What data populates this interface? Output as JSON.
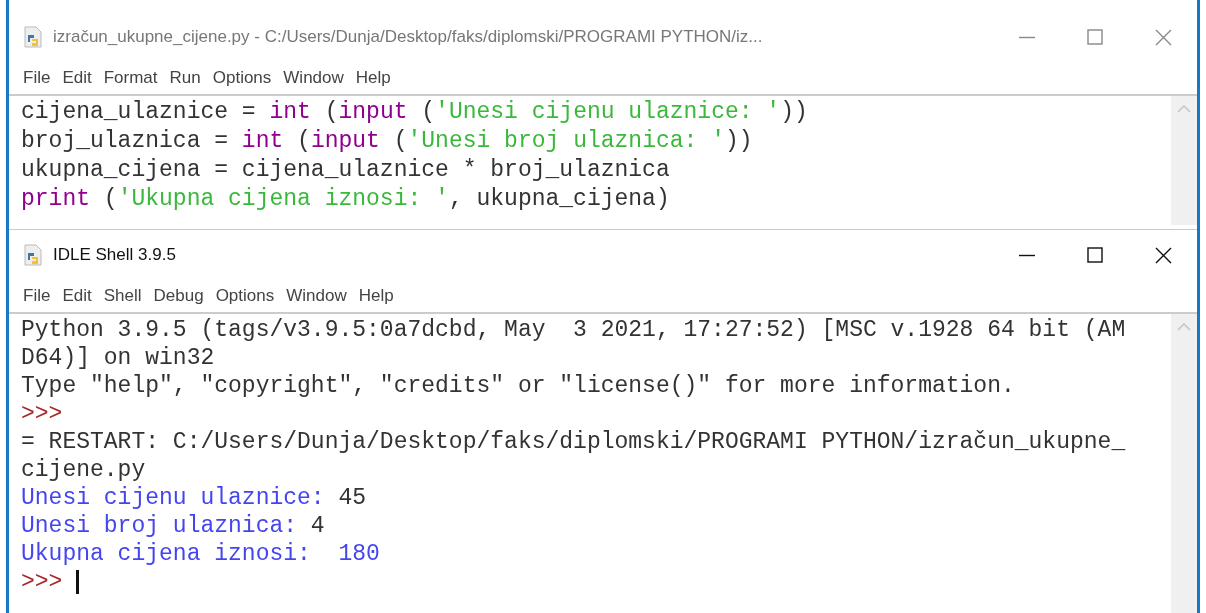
{
  "editor_window": {
    "title": "izračun_ukupne_cijene.py - C:/Users/Dunja/Desktop/faks/diplomski/PROGRAMI PYTHON/iz...",
    "active": false,
    "menu": [
      "File",
      "Edit",
      "Format",
      "Run",
      "Options",
      "Window",
      "Help"
    ],
    "code_lines": [
      {
        "segments": [
          {
            "kind": "plain",
            "text": "cijena_ulaznice = "
          },
          {
            "kind": "builtin",
            "text": "int"
          },
          {
            "kind": "plain",
            "text": " ("
          },
          {
            "kind": "builtin",
            "text": "input"
          },
          {
            "kind": "plain",
            "text": " ("
          },
          {
            "kind": "string",
            "text": "'Unesi cijenu ulaznice: '"
          },
          {
            "kind": "plain",
            "text": "))"
          }
        ]
      },
      {
        "segments": [
          {
            "kind": "plain",
            "text": "broj_ulaznica = "
          },
          {
            "kind": "builtin",
            "text": "int"
          },
          {
            "kind": "plain",
            "text": " ("
          },
          {
            "kind": "builtin",
            "text": "input"
          },
          {
            "kind": "plain",
            "text": " ("
          },
          {
            "kind": "string",
            "text": "'Unesi broj ulaznica: '"
          },
          {
            "kind": "plain",
            "text": "))"
          }
        ]
      },
      {
        "segments": [
          {
            "kind": "plain",
            "text": "ukupna_cijena = cijena_ulaznice * broj_ulaznica"
          }
        ]
      },
      {
        "segments": [
          {
            "kind": "builtin",
            "text": "print"
          },
          {
            "kind": "plain",
            "text": " ("
          },
          {
            "kind": "string",
            "text": "'Ukupna cijena iznosi: '"
          },
          {
            "kind": "plain",
            "text": ", ukupna_cijena)"
          }
        ]
      }
    ]
  },
  "shell_window": {
    "title": "IDLE Shell 3.9.5",
    "active": true,
    "menu": [
      "File",
      "Edit",
      "Shell",
      "Debug",
      "Options",
      "Window",
      "Help"
    ],
    "lines": [
      {
        "segments": [
          {
            "kind": "plain",
            "text": "Python 3.9.5 (tags/v3.9.5:0a7dcbd, May  3 2021, 17:27:52) [MSC v.1928 64 bit (AM"
          }
        ]
      },
      {
        "segments": [
          {
            "kind": "plain",
            "text": "D64)] on win32"
          }
        ]
      },
      {
        "segments": [
          {
            "kind": "plain",
            "text": "Type \"help\", \"copyright\", \"credits\" or \"license()\" for more information."
          }
        ]
      },
      {
        "segments": [
          {
            "kind": "prompt",
            "text": ">>>"
          }
        ]
      },
      {
        "segments": [
          {
            "kind": "plain",
            "text": "= RESTART: C:/Users/Dunja/Desktop/faks/diplomski/PROGRAMI PYTHON/izračun_ukupne_"
          }
        ]
      },
      {
        "segments": [
          {
            "kind": "plain",
            "text": "cijene.py"
          }
        ]
      },
      {
        "segments": [
          {
            "kind": "stdout",
            "text": "Unesi cijenu ulaznice: "
          },
          {
            "kind": "plain",
            "text": "45"
          }
        ]
      },
      {
        "segments": [
          {
            "kind": "stdout",
            "text": "Unesi broj ulaznica: "
          },
          {
            "kind": "plain",
            "text": "4"
          }
        ]
      },
      {
        "segments": [
          {
            "kind": "stdout",
            "text": "Ukupna cijena iznosi:  180"
          }
        ]
      },
      {
        "segments": [
          {
            "kind": "prompt",
            "text": ">>> "
          }
        ],
        "cursor": true
      }
    ]
  }
}
